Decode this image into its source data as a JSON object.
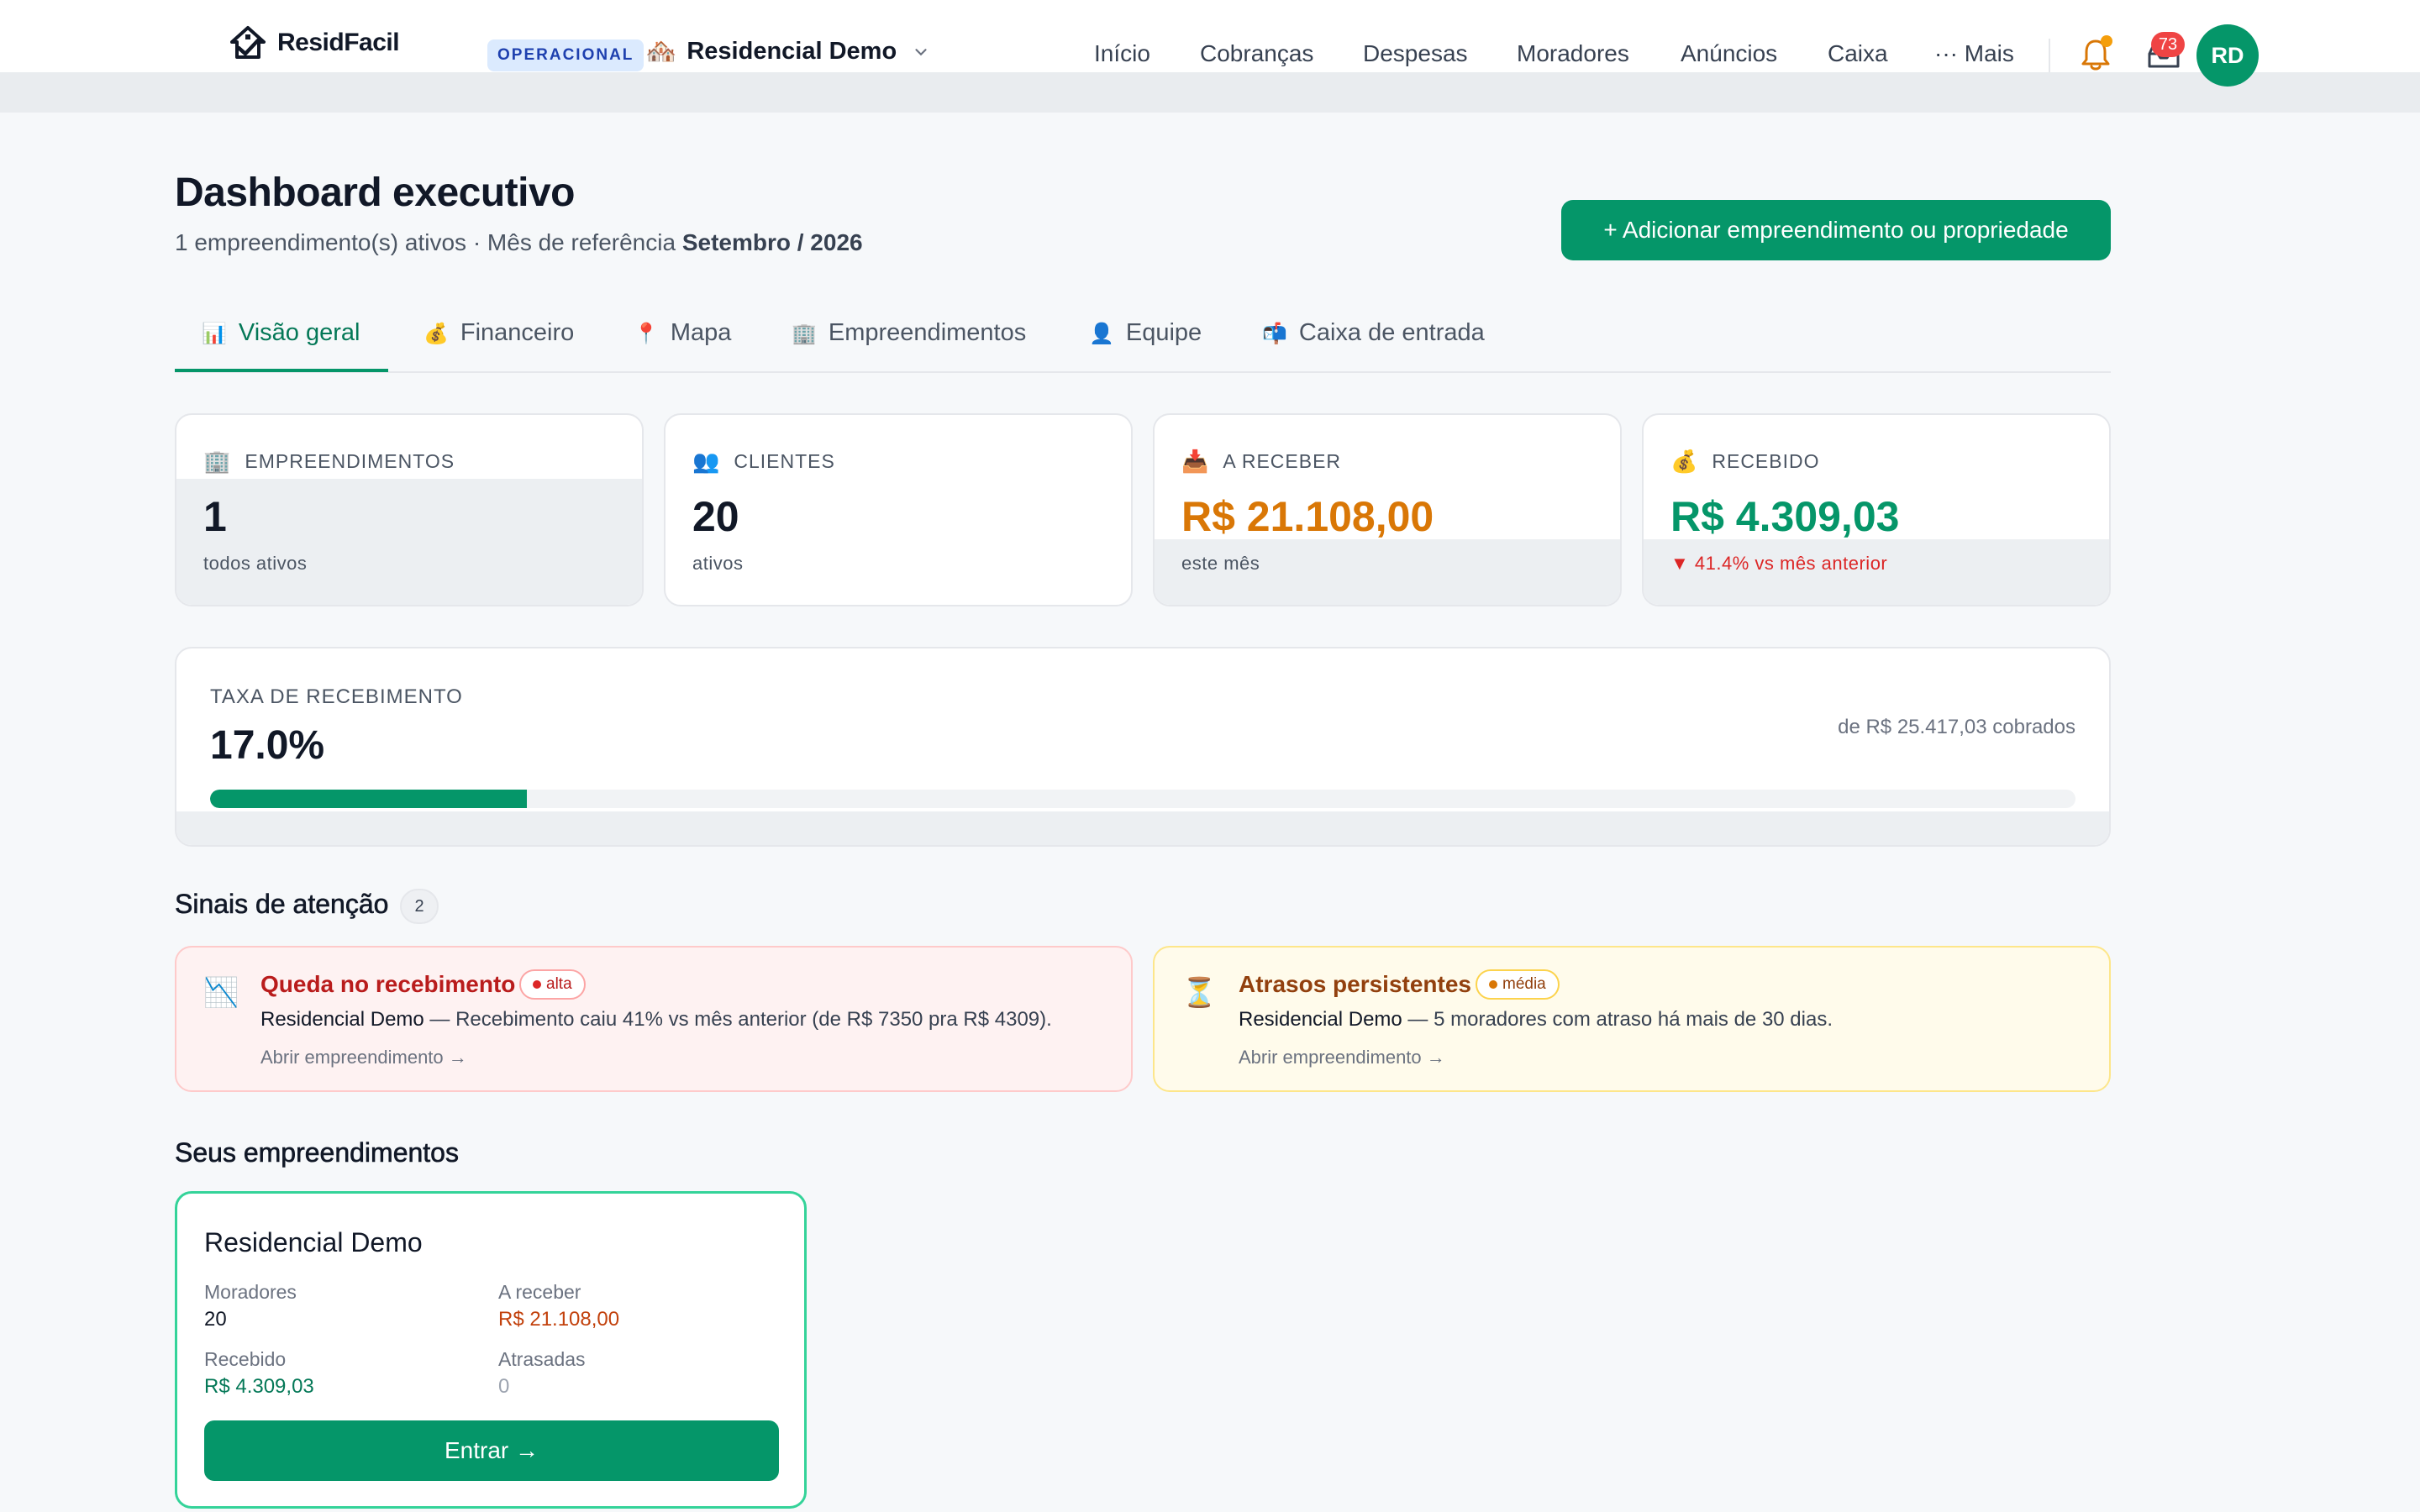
{
  "app": {
    "name": "ResidFacil"
  },
  "header": {
    "env_badge": "OPERACIONAL",
    "property_emoji": "🏘️",
    "property_name": "Residencial Demo",
    "nav": [
      "Início",
      "Cobranças",
      "Despesas",
      "Moradores",
      "Anúncios",
      "Caixa",
      "··· Mais"
    ],
    "inbox_count": "73",
    "avatar_initials": "RD",
    "icons": {
      "bell": "bell-icon",
      "inbox": "inbox-icon",
      "chevron": "chevron-down-icon"
    }
  },
  "page": {
    "title": "Dashboard executivo",
    "subtitle_prefix": "1 empreendimento(s) ativos · Mês de referência ",
    "reference_month": "Setembro / 2026",
    "add_button": "+ Adicionar empreendimento ou propriedade"
  },
  "tabs": [
    {
      "icon": "📊",
      "label": "Visão geral",
      "active": true
    },
    {
      "icon": "💰",
      "label": "Financeiro"
    },
    {
      "icon": "📍",
      "label": "Mapa"
    },
    {
      "icon": "🏢",
      "label": "Empreendimentos"
    },
    {
      "icon": "👤",
      "label": "Equipe"
    },
    {
      "icon": "📬",
      "label": "Caixa de entrada"
    }
  ],
  "stats": [
    {
      "icon": "🏢",
      "label": "EMPREENDIMENTOS",
      "value": "1",
      "note": "todos ativos"
    },
    {
      "icon": "👥",
      "label": "CLIENTES",
      "value": "20",
      "note": "ativos"
    },
    {
      "icon": "📥",
      "label": "A RECEBER",
      "value": "R$ 21.108,00",
      "note": "este mês"
    },
    {
      "icon": "💰",
      "label": "RECEBIDO",
      "value": "R$ 4.309,03",
      "note": "▼ 41.4% vs mês anterior"
    }
  ],
  "colors": {
    "accent": "#059669",
    "orange": "#d97706",
    "red": "#dc2626",
    "green": "#059669"
  },
  "collection_rate": {
    "label": "TAXA DE RECEBIMENTO",
    "value": "17.0%",
    "of_text": "de R$ 25.417,03 cobrados",
    "progress": 0.17
  },
  "attention": {
    "title": "Sinais de atenção",
    "count": "2",
    "alerts": [
      {
        "icon": "📉",
        "title": "Queda no recebimento",
        "severity": "alta",
        "property": "Residencial Demo",
        "message": " — Recebimento caiu 41% vs mês anterior (de R$ 7350 pra R$ 4309).",
        "link": "Abrir empreendimento →"
      },
      {
        "icon": "⏳",
        "title": "Atrasos persistentes",
        "severity": "média",
        "property": "Residencial Demo",
        "message": " — 5 moradores com atraso há mais de 30 dias.",
        "link": "Abrir empreendimento →"
      }
    ]
  },
  "properties": {
    "title": "Seus empreendimentos",
    "items": [
      {
        "name": "Residencial Demo",
        "residents_label": "Moradores",
        "residents": "20",
        "receivable_label": "A receber",
        "receivable": "R$ 21.108,00",
        "received_label": "Recebido",
        "received": "R$ 4.309,03",
        "overdue_label": "Atrasadas",
        "overdue": "0",
        "enter_button": "Entrar →"
      }
    ]
  }
}
